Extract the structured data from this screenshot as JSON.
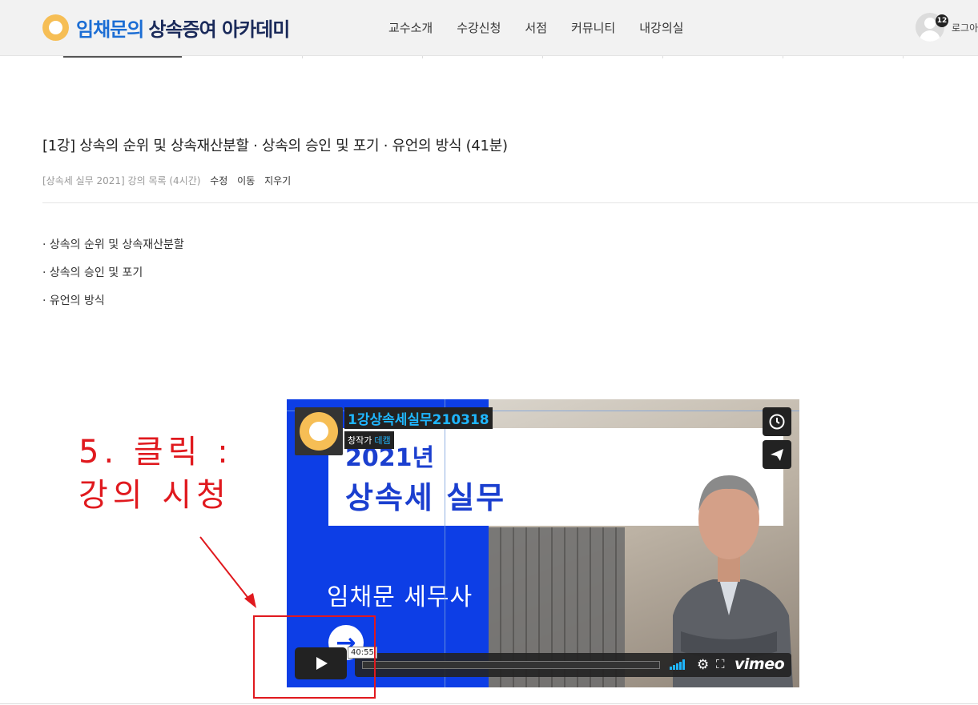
{
  "header": {
    "logo_name": "임채문의",
    "logo_sub": "상속증여 아카데미",
    "nav": [
      "교수소개",
      "수강신청",
      "서점",
      "커뮤니티",
      "내강의실"
    ],
    "notification_count": "12",
    "login_label": "로그아"
  },
  "post": {
    "title": "[1강] 상속의 순위 및 상속재산분할 · 상속의 승인 및 포기 · 유언의 방식 (41분)",
    "breadcrumb": "[상속세 실무 2021] 강의 목록 (4시간)",
    "actions": [
      "수정",
      "이동",
      "지우기"
    ],
    "bullets": [
      "· 상속의 순위 및 상속재산분할",
      "· 상속의 승인 및 포기",
      "· 유언의 방식"
    ]
  },
  "annotation": {
    "line1": "5. 클릭 :",
    "line2": "강의 시청"
  },
  "video": {
    "title": "1강상속세실무210318",
    "byline_prefix": "창작가",
    "byline_owner": "데캠",
    "thumb_year": "2021년",
    "thumb_title": "상속세 실무",
    "thumb_presenter": "임채문 세무사",
    "duration": "40:55",
    "brand": "vimeo",
    "progress": 0
  },
  "colors": {
    "brand_blue": "#1b6dd4",
    "logo_yellow": "#f6be55",
    "annotation_red": "#e0191e",
    "vimeo_accent": "#1fb6ff",
    "thumb_blue": "#0d3ee6"
  }
}
